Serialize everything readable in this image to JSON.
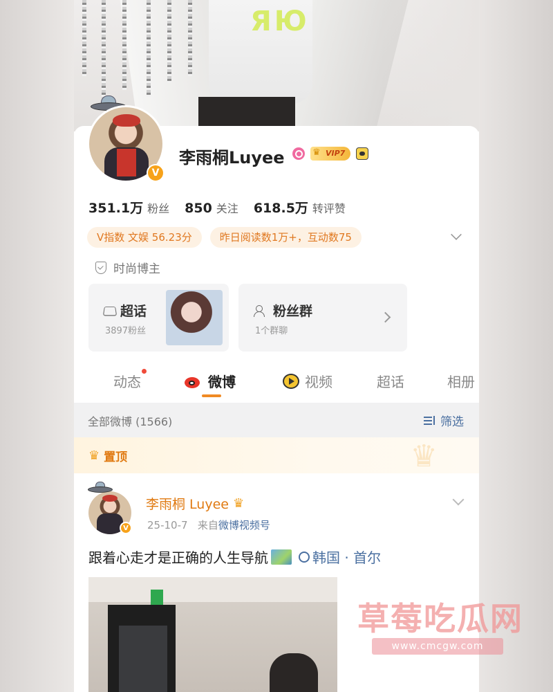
{
  "profile": {
    "name": "李雨桐Luyee",
    "vip_label": "VIP7",
    "verified_mark": "V",
    "stats": [
      {
        "value": "351.1万",
        "label": "粉丝"
      },
      {
        "value": "850",
        "label": "关注"
      },
      {
        "value": "618.5万",
        "label": "转评赞"
      }
    ],
    "chips": [
      "V指数 文娱 56.23分",
      "昨日阅读数1万+，互动数75"
    ],
    "tagline": "时尚博主"
  },
  "cover": {
    "shirt_text": "ЯЮ"
  },
  "cards": {
    "supertopic": {
      "title": "超话",
      "sub": "3897粉丝"
    },
    "fangroup": {
      "title": "粉丝群",
      "sub": "1个群聊"
    }
  },
  "tabs": [
    "动态",
    "微博",
    "视频",
    "超话",
    "相册"
  ],
  "filterbar": {
    "count": "全部微博 (1566)",
    "filter": "筛选"
  },
  "pinned": {
    "label": "置顶"
  },
  "post": {
    "name": "李雨桐 Luyee",
    "date": "25-10-7",
    "from_prefix": "来自",
    "source": "微博视频号",
    "text": "跟着心走才是正确的人生导航",
    "location": "韩国 · 首尔"
  },
  "watermark": {
    "title": "草莓吃瓜网",
    "url": "www.cmcgw.com"
  },
  "colors": {
    "accent": "#f08a24",
    "link": "#4a6fa0",
    "chip_bg": "#fdf1e3",
    "verified": "#f7a21a"
  }
}
